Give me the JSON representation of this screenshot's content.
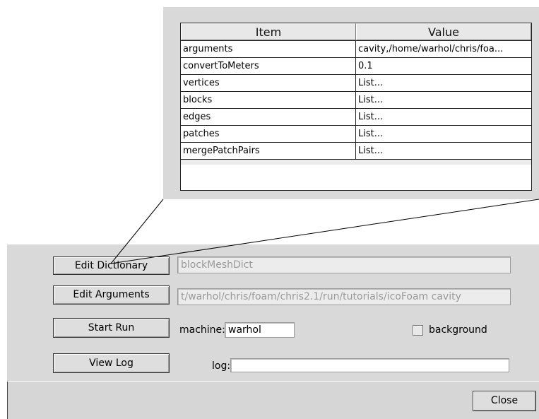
{
  "dict_table": {
    "columns": [
      "Item",
      "Value"
    ],
    "rows": [
      [
        "arguments",
        "cavity,/home/warhol/chris/foa..."
      ],
      [
        "convertToMeters",
        "0.1"
      ],
      [
        "vertices",
        "List..."
      ],
      [
        "blocks",
        "List..."
      ],
      [
        "edges",
        "List..."
      ],
      [
        "patches",
        "List..."
      ],
      [
        "mergePatchPairs",
        "List..."
      ]
    ]
  },
  "panel": {
    "edit_dictionary_label": "Edit Dictionary",
    "dictionary_value": "blockMeshDict",
    "edit_arguments_label": "Edit Arguments",
    "arguments_value": "t/warhol/chris/foam/chris2.1/run/tutorials/icoFoam cavity",
    "start_run_label": "Start Run",
    "machine_label": "machine:",
    "machine_value": "warhol",
    "background_label": "background",
    "view_log_label": "View Log",
    "log_label": "log:",
    "log_value": "",
    "close_label": "Close"
  }
}
